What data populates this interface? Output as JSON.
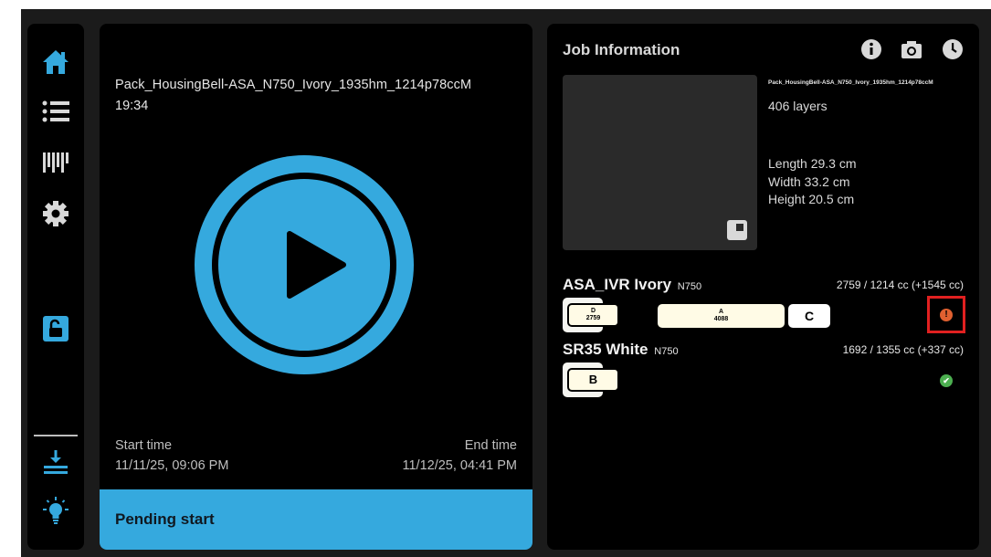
{
  "colors": {
    "accent": "#35a9de",
    "panel": "#000000",
    "background": "#1b1b1b",
    "alert": "#e06030",
    "ok": "#4caf50",
    "highlight_border": "#e02020"
  },
  "sidebar": {
    "items": [
      {
        "name": "home",
        "icon": "home-icon"
      },
      {
        "name": "jobs-list",
        "icon": "list-icon"
      },
      {
        "name": "materials",
        "icon": "cartridges-icon"
      },
      {
        "name": "settings",
        "icon": "gear-icon"
      },
      {
        "name": "lock",
        "icon": "unlock-icon"
      },
      {
        "name": "download",
        "icon": "download-icon"
      },
      {
        "name": "light",
        "icon": "lightbulb-icon"
      }
    ]
  },
  "print": {
    "job_name": "Pack_HousingBell-ASA_N750_Ivory_1935hm_1214p78ccM",
    "duration": "19:34",
    "start_label": "Start time",
    "start_value": "11/11/25, 09:06 PM",
    "end_label": "End time",
    "end_value": "11/12/25, 04:41 PM",
    "status": "Pending start"
  },
  "info": {
    "title": "Job Information",
    "header_icons": [
      "info-icon",
      "camera-icon",
      "clock-icon"
    ],
    "file_name": "Pack_HousingBell-ASA_N750_Ivory_1935hm_1214p78ccM",
    "layers": "406 layers",
    "length": "Length 29.3 cm",
    "width": "Width 33.2 cm",
    "height": "Height 20.5 cm",
    "materials": [
      {
        "name": "ASA_IVR Ivory",
        "sub": "N750",
        "volume": "2759 / 1214 cc (+1545 cc)",
        "cartridges": [
          {
            "letter": "D",
            "value": "2759"
          },
          {
            "letter": "A",
            "value": "4088"
          },
          {
            "letter": "C",
            "value": ""
          }
        ],
        "status_icon": "alert-icon",
        "status_symbol": "!"
      },
      {
        "name": "SR35 White",
        "sub": "N750",
        "volume": "1692 / 1355 cc (+337 cc)",
        "cartridges": [
          {
            "letter": "B",
            "value": ""
          }
        ],
        "status_icon": "check-icon",
        "status_symbol": "✔"
      }
    ]
  }
}
